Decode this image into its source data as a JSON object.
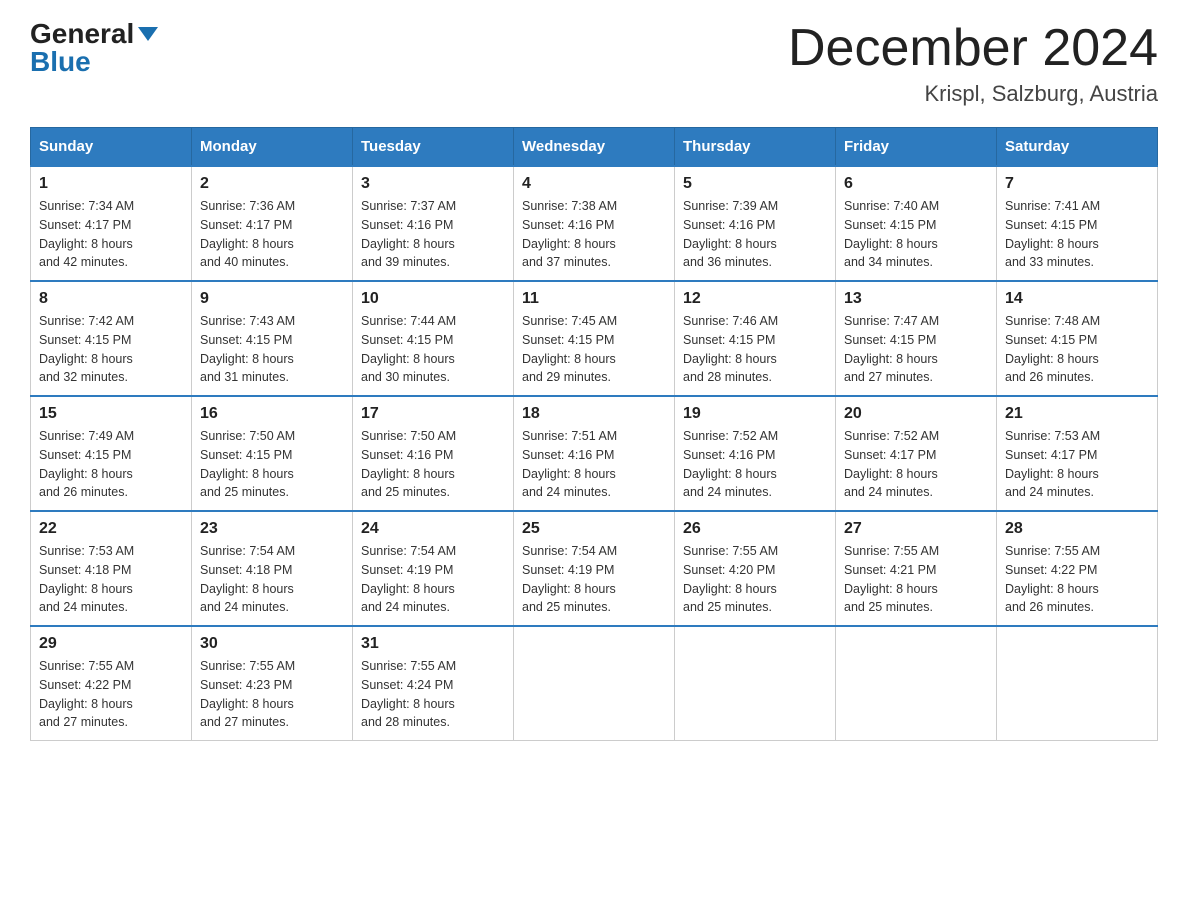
{
  "header": {
    "logo_general": "General",
    "logo_blue": "Blue",
    "month_title": "December 2024",
    "location": "Krispl, Salzburg, Austria"
  },
  "weekdays": [
    "Sunday",
    "Monday",
    "Tuesday",
    "Wednesday",
    "Thursday",
    "Friday",
    "Saturday"
  ],
  "weeks": [
    [
      {
        "day": "1",
        "sunrise": "Sunrise: 7:34 AM",
        "sunset": "Sunset: 4:17 PM",
        "daylight": "Daylight: 8 hours",
        "daylight2": "and 42 minutes."
      },
      {
        "day": "2",
        "sunrise": "Sunrise: 7:36 AM",
        "sunset": "Sunset: 4:17 PM",
        "daylight": "Daylight: 8 hours",
        "daylight2": "and 40 minutes."
      },
      {
        "day": "3",
        "sunrise": "Sunrise: 7:37 AM",
        "sunset": "Sunset: 4:16 PM",
        "daylight": "Daylight: 8 hours",
        "daylight2": "and 39 minutes."
      },
      {
        "day": "4",
        "sunrise": "Sunrise: 7:38 AM",
        "sunset": "Sunset: 4:16 PM",
        "daylight": "Daylight: 8 hours",
        "daylight2": "and 37 minutes."
      },
      {
        "day": "5",
        "sunrise": "Sunrise: 7:39 AM",
        "sunset": "Sunset: 4:16 PM",
        "daylight": "Daylight: 8 hours",
        "daylight2": "and 36 minutes."
      },
      {
        "day": "6",
        "sunrise": "Sunrise: 7:40 AM",
        "sunset": "Sunset: 4:15 PM",
        "daylight": "Daylight: 8 hours",
        "daylight2": "and 34 minutes."
      },
      {
        "day": "7",
        "sunrise": "Sunrise: 7:41 AM",
        "sunset": "Sunset: 4:15 PM",
        "daylight": "Daylight: 8 hours",
        "daylight2": "and 33 minutes."
      }
    ],
    [
      {
        "day": "8",
        "sunrise": "Sunrise: 7:42 AM",
        "sunset": "Sunset: 4:15 PM",
        "daylight": "Daylight: 8 hours",
        "daylight2": "and 32 minutes."
      },
      {
        "day": "9",
        "sunrise": "Sunrise: 7:43 AM",
        "sunset": "Sunset: 4:15 PM",
        "daylight": "Daylight: 8 hours",
        "daylight2": "and 31 minutes."
      },
      {
        "day": "10",
        "sunrise": "Sunrise: 7:44 AM",
        "sunset": "Sunset: 4:15 PM",
        "daylight": "Daylight: 8 hours",
        "daylight2": "and 30 minutes."
      },
      {
        "day": "11",
        "sunrise": "Sunrise: 7:45 AM",
        "sunset": "Sunset: 4:15 PM",
        "daylight": "Daylight: 8 hours",
        "daylight2": "and 29 minutes."
      },
      {
        "day": "12",
        "sunrise": "Sunrise: 7:46 AM",
        "sunset": "Sunset: 4:15 PM",
        "daylight": "Daylight: 8 hours",
        "daylight2": "and 28 minutes."
      },
      {
        "day": "13",
        "sunrise": "Sunrise: 7:47 AM",
        "sunset": "Sunset: 4:15 PM",
        "daylight": "Daylight: 8 hours",
        "daylight2": "and 27 minutes."
      },
      {
        "day": "14",
        "sunrise": "Sunrise: 7:48 AM",
        "sunset": "Sunset: 4:15 PM",
        "daylight": "Daylight: 8 hours",
        "daylight2": "and 26 minutes."
      }
    ],
    [
      {
        "day": "15",
        "sunrise": "Sunrise: 7:49 AM",
        "sunset": "Sunset: 4:15 PM",
        "daylight": "Daylight: 8 hours",
        "daylight2": "and 26 minutes."
      },
      {
        "day": "16",
        "sunrise": "Sunrise: 7:50 AM",
        "sunset": "Sunset: 4:15 PM",
        "daylight": "Daylight: 8 hours",
        "daylight2": "and 25 minutes."
      },
      {
        "day": "17",
        "sunrise": "Sunrise: 7:50 AM",
        "sunset": "Sunset: 4:16 PM",
        "daylight": "Daylight: 8 hours",
        "daylight2": "and 25 minutes."
      },
      {
        "day": "18",
        "sunrise": "Sunrise: 7:51 AM",
        "sunset": "Sunset: 4:16 PM",
        "daylight": "Daylight: 8 hours",
        "daylight2": "and 24 minutes."
      },
      {
        "day": "19",
        "sunrise": "Sunrise: 7:52 AM",
        "sunset": "Sunset: 4:16 PM",
        "daylight": "Daylight: 8 hours",
        "daylight2": "and 24 minutes."
      },
      {
        "day": "20",
        "sunrise": "Sunrise: 7:52 AM",
        "sunset": "Sunset: 4:17 PM",
        "daylight": "Daylight: 8 hours",
        "daylight2": "and 24 minutes."
      },
      {
        "day": "21",
        "sunrise": "Sunrise: 7:53 AM",
        "sunset": "Sunset: 4:17 PM",
        "daylight": "Daylight: 8 hours",
        "daylight2": "and 24 minutes."
      }
    ],
    [
      {
        "day": "22",
        "sunrise": "Sunrise: 7:53 AM",
        "sunset": "Sunset: 4:18 PM",
        "daylight": "Daylight: 8 hours",
        "daylight2": "and 24 minutes."
      },
      {
        "day": "23",
        "sunrise": "Sunrise: 7:54 AM",
        "sunset": "Sunset: 4:18 PM",
        "daylight": "Daylight: 8 hours",
        "daylight2": "and 24 minutes."
      },
      {
        "day": "24",
        "sunrise": "Sunrise: 7:54 AM",
        "sunset": "Sunset: 4:19 PM",
        "daylight": "Daylight: 8 hours",
        "daylight2": "and 24 minutes."
      },
      {
        "day": "25",
        "sunrise": "Sunrise: 7:54 AM",
        "sunset": "Sunset: 4:19 PM",
        "daylight": "Daylight: 8 hours",
        "daylight2": "and 25 minutes."
      },
      {
        "day": "26",
        "sunrise": "Sunrise: 7:55 AM",
        "sunset": "Sunset: 4:20 PM",
        "daylight": "Daylight: 8 hours",
        "daylight2": "and 25 minutes."
      },
      {
        "day": "27",
        "sunrise": "Sunrise: 7:55 AM",
        "sunset": "Sunset: 4:21 PM",
        "daylight": "Daylight: 8 hours",
        "daylight2": "and 25 minutes."
      },
      {
        "day": "28",
        "sunrise": "Sunrise: 7:55 AM",
        "sunset": "Sunset: 4:22 PM",
        "daylight": "Daylight: 8 hours",
        "daylight2": "and 26 minutes."
      }
    ],
    [
      {
        "day": "29",
        "sunrise": "Sunrise: 7:55 AM",
        "sunset": "Sunset: 4:22 PM",
        "daylight": "Daylight: 8 hours",
        "daylight2": "and 27 minutes."
      },
      {
        "day": "30",
        "sunrise": "Sunrise: 7:55 AM",
        "sunset": "Sunset: 4:23 PM",
        "daylight": "Daylight: 8 hours",
        "daylight2": "and 27 minutes."
      },
      {
        "day": "31",
        "sunrise": "Sunrise: 7:55 AM",
        "sunset": "Sunset: 4:24 PM",
        "daylight": "Daylight: 8 hours",
        "daylight2": "and 28 minutes."
      },
      {
        "day": "",
        "sunrise": "",
        "sunset": "",
        "daylight": "",
        "daylight2": ""
      },
      {
        "day": "",
        "sunrise": "",
        "sunset": "",
        "daylight": "",
        "daylight2": ""
      },
      {
        "day": "",
        "sunrise": "",
        "sunset": "",
        "daylight": "",
        "daylight2": ""
      },
      {
        "day": "",
        "sunrise": "",
        "sunset": "",
        "daylight": "",
        "daylight2": ""
      }
    ]
  ]
}
